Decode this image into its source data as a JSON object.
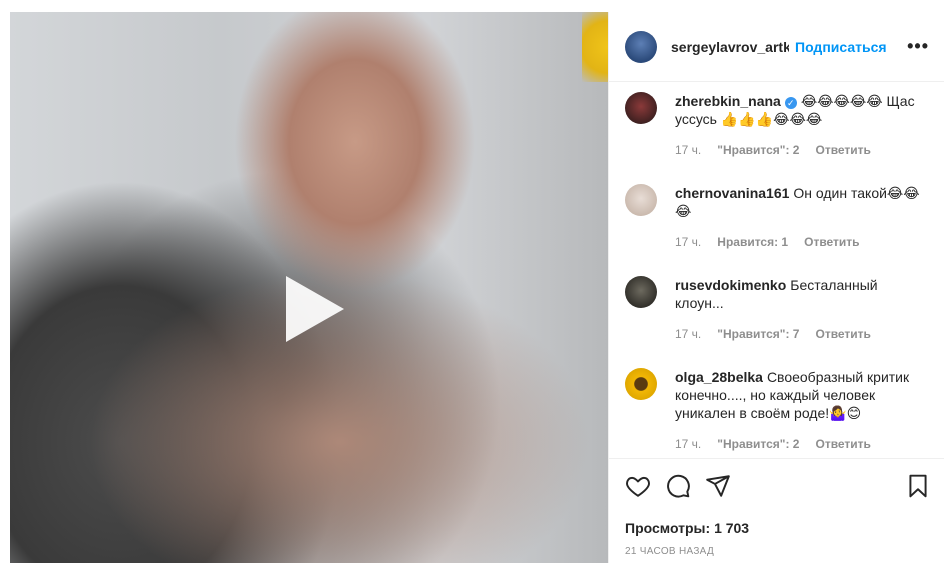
{
  "post": {
    "username": "sergeylavrov_artkritik",
    "follow_label": "Подписаться",
    "more_label": "•••",
    "views_label": "Просмотры:",
    "views_count": "1 703",
    "time_ago": "21 ЧАСОВ НАЗАД"
  },
  "comments": [
    {
      "author": "zherebkin_nana",
      "verified": true,
      "text": "😂😂😂😂😂 Щас уссусь 👍👍👍😂😂😂",
      "time": "17 ч.",
      "likes": "\"Нравится\": 2",
      "reply": "Ответить"
    },
    {
      "author": "chernovanina161",
      "text": "Он один такой😂😂😂",
      "time": "17 ч.",
      "likes": "Нравится: 1",
      "reply": "Ответить"
    },
    {
      "author": "rusevdokimenko",
      "text": "Бесталанный клоун...",
      "time": "17 ч.",
      "likes": "\"Нравится\": 7",
      "reply": "Ответить"
    },
    {
      "author": "olga_28belka",
      "text": "Своеобразный критик конечно...., но каждый человек уникален в своём роде!🤷‍♀️😊",
      "time": "17 ч.",
      "likes": "\"Нравится\": 2",
      "reply": "Ответить"
    }
  ],
  "icons": {
    "like": "heart-icon",
    "comment": "comment-icon",
    "share": "share-icon",
    "save": "bookmark-icon",
    "play": "play-icon"
  }
}
